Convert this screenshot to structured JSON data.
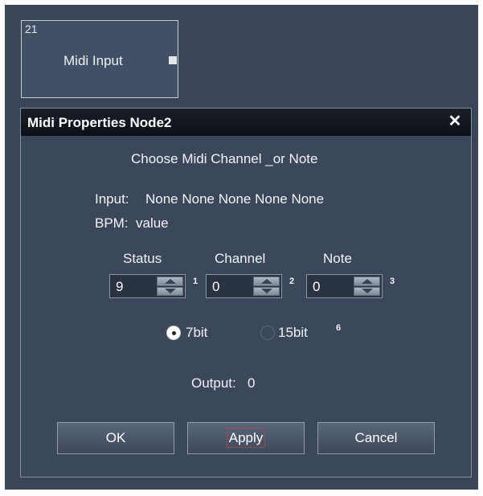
{
  "node": {
    "id": "21",
    "label": "Midi Input"
  },
  "dialog": {
    "title": "Midi Properties Node2",
    "close_glyph": "✕",
    "heading": "Choose Midi Channel _or Note",
    "input_label": "Input:",
    "input_values": "None None None None None",
    "bpm_label": "BPM:",
    "bpm_value": "value",
    "columns": {
      "status": {
        "label": "Status",
        "value": "9",
        "index": "1"
      },
      "channel": {
        "label": "Channel",
        "value": "0",
        "index": "2"
      },
      "note": {
        "label": "Note",
        "value": "0",
        "index": "3"
      }
    },
    "bit_modes": [
      {
        "label": "7bit",
        "selected": true
      },
      {
        "label": "15bit",
        "selected": false,
        "index": "6"
      }
    ],
    "output_label": "Output:",
    "output_value": "0",
    "buttons": {
      "ok": "OK",
      "apply": "Apply",
      "cancel": "Cancel"
    }
  },
  "colors": {
    "background": "#3a4658",
    "titlebar": "#0c0f15",
    "accent": "#ffffff"
  }
}
